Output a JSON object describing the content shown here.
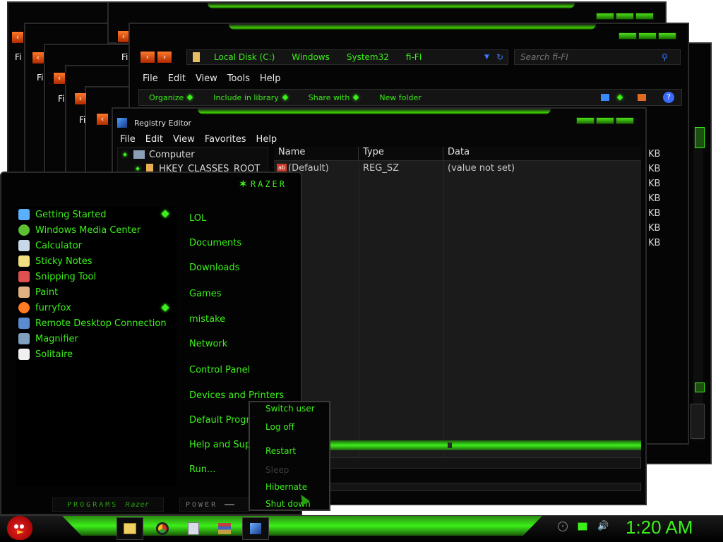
{
  "explorer": {
    "address": [
      "Local Disk (C:)",
      "Windows",
      "System32",
      "fi-FI"
    ],
    "search_placeholder": "Search fi-FI",
    "menu": [
      "File",
      "Edit",
      "View",
      "Tools",
      "Help"
    ],
    "toolbar": [
      "Organize",
      "Include in library",
      "Share with",
      "New folder"
    ],
    "ghost_menu": "Fi",
    "size_unit": "KB"
  },
  "regedit": {
    "title": "Registry Editor",
    "menu": [
      "File",
      "Edit",
      "View",
      "Favorites",
      "Help"
    ],
    "tree": [
      "Computer",
      "HKEY_CLASSES_ROOT"
    ],
    "columns": [
      "Name",
      "Type",
      "Data"
    ],
    "row": {
      "name": "(Default)",
      "type": "REG_SZ",
      "data": "(value not set)"
    }
  },
  "start_menu": {
    "logo": "RAZER",
    "programs": [
      "Getting Started",
      "Windows Media Center",
      "Calculator",
      "Sticky Notes",
      "Snipping Tool",
      "Paint",
      "furryfox",
      "Remote Desktop Connection",
      "Magnifier",
      "Solitaire"
    ],
    "places": [
      "LOL",
      "Documents",
      "Downloads",
      "Games",
      "mistake",
      "Network",
      "Control Panel",
      "Devices and Printers",
      "Default Programs",
      "Help and Support",
      "Run..."
    ],
    "programs_label": "PROGRAMS",
    "programs_brand": "Razer",
    "power_label": "POWER"
  },
  "power_menu": [
    "Switch user",
    "Log off",
    "Restart",
    "Sleep",
    "Hibernate",
    "Shut down"
  ],
  "taskbar": {
    "clock": "1:20 AM"
  },
  "colors": {
    "accent": "#3cf01a",
    "bg": "#050505",
    "orange": "#ff6a1a"
  }
}
